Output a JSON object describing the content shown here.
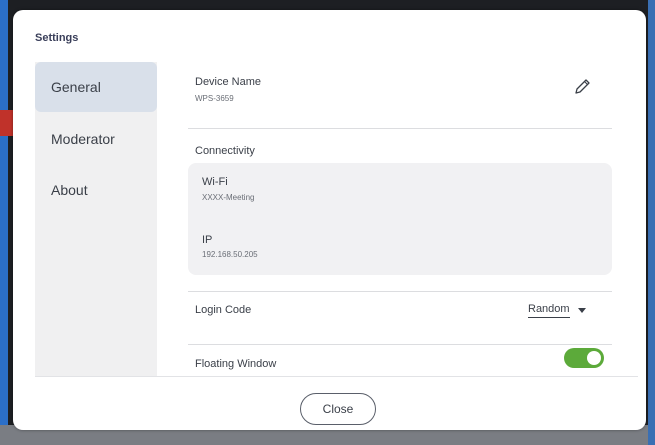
{
  "dialog": {
    "title": "Settings"
  },
  "sidebar": {
    "items": [
      {
        "label": "General",
        "active": true
      },
      {
        "label": "Moderator",
        "active": false
      },
      {
        "label": "About",
        "active": false
      }
    ]
  },
  "general": {
    "device_name": {
      "label": "Device Name",
      "value": "WPS-3659",
      "edit_icon": "pencil-icon"
    },
    "connectivity": {
      "label": "Connectivity",
      "wifi": {
        "label": "Wi-Fi",
        "value": "XXXX-Meeting"
      },
      "ip": {
        "label": "IP",
        "value": "192.168.50.205"
      }
    },
    "login_code": {
      "label": "Login Code",
      "selected": "Random"
    },
    "floating_window": {
      "label": "Floating Window",
      "enabled": true
    }
  },
  "footer": {
    "close_label": "Close"
  },
  "colors": {
    "toggle_on": "#5caa3a",
    "sidebar_active": "#d9e0ea",
    "title": "#3a3f5a"
  }
}
